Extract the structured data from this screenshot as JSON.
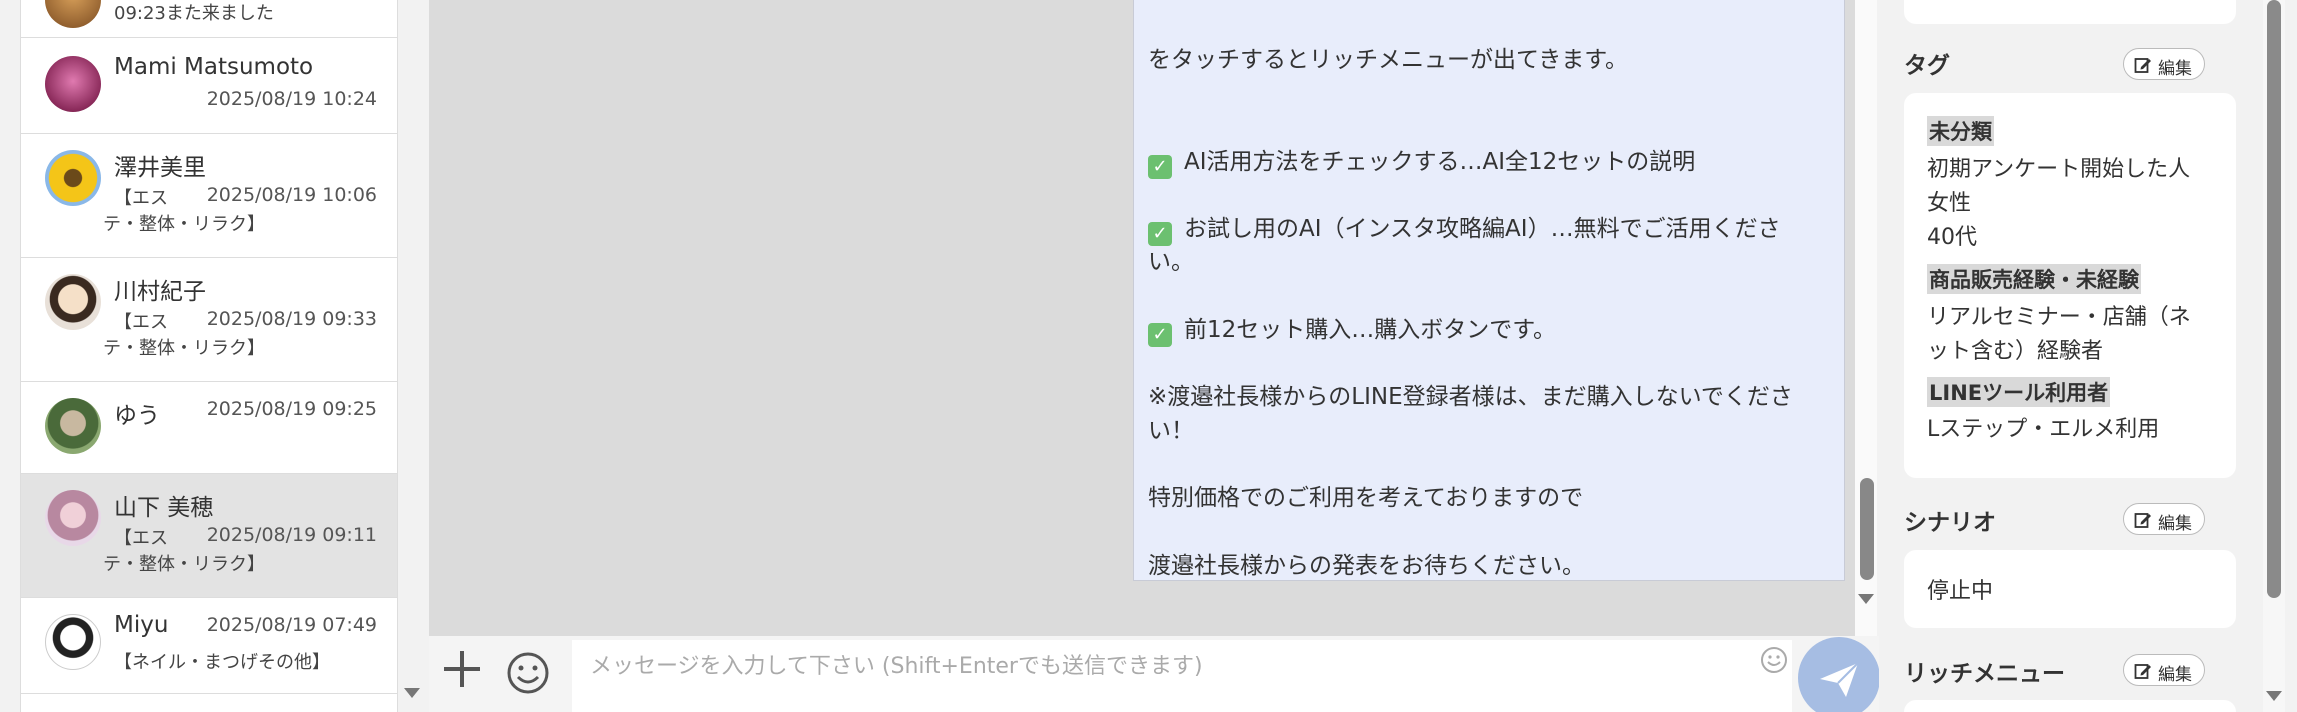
{
  "contacts": [
    {
      "name": "",
      "date": "",
      "sub": "09:23また来ました"
    },
    {
      "name": "Mami Matsumoto",
      "date": "2025/08/19 10:24",
      "sub": ""
    },
    {
      "name": "澤井美里",
      "date": "2025/08/19 10:06",
      "sub1": "【エス",
      "sub2": "テ・整体・リラク】"
    },
    {
      "name": "川村紀子",
      "date": "2025/08/19 09:33",
      "sub1": "【エス",
      "sub2": "テ・整体・リラク】"
    },
    {
      "name": "ゆう",
      "date": "2025/08/19 09:25",
      "sub": ""
    },
    {
      "name": "山下 美穂",
      "date": "2025/08/19 09:11",
      "sub1": "【エス",
      "sub2": "テ・整体・リラク】"
    },
    {
      "name": "Miyu",
      "date": "2025/08/19 07:49",
      "sub": "【ネイル・まつげその他】"
    }
  ],
  "message": {
    "lines": [
      "をタッチするとリッチメニューが出てきます。",
      "AI活用方法をチェックする…AI全12セットの説明",
      "お試し用のAI（インスタ攻略編AI）…無料でご活用くださ",
      "い。",
      "前12セット購入…購入ボタンです。",
      "※渡邉社長様からのLINE登録者様は、まだ購入しないでくださ",
      "い！",
      "特別価格でのご利用を考えておりますので",
      "渡邉社長様からの発表をお待ちください。"
    ]
  },
  "composer": {
    "placeholder": "メッセージを入力して下さい (Shift+Enterでも送信できます)"
  },
  "panel": {
    "tag_title": "タグ",
    "scenario_title": "シナリオ",
    "richmenu_title": "リッチメニュー",
    "edit_label": "編集",
    "tags": {
      "group1_head": "未分類",
      "group1_items": [
        "初期アンケート開始した人",
        "女性",
        "40代"
      ],
      "group2_head": "商品販売経験・未経験",
      "group2_items": [
        "リアルセミナー・店舗（ネ",
        "ット含む）経験者"
      ],
      "group3_head": "LINEツール利用者",
      "group3_items": [
        "Lステップ・エルメ利用"
      ]
    },
    "scenario_status": "停止中"
  },
  "colors": {
    "bubble_bg": "#e8edfb",
    "check_green": "#6cc070",
    "send_button": "#a6bde3",
    "selected_row": "#e3e3e3"
  }
}
